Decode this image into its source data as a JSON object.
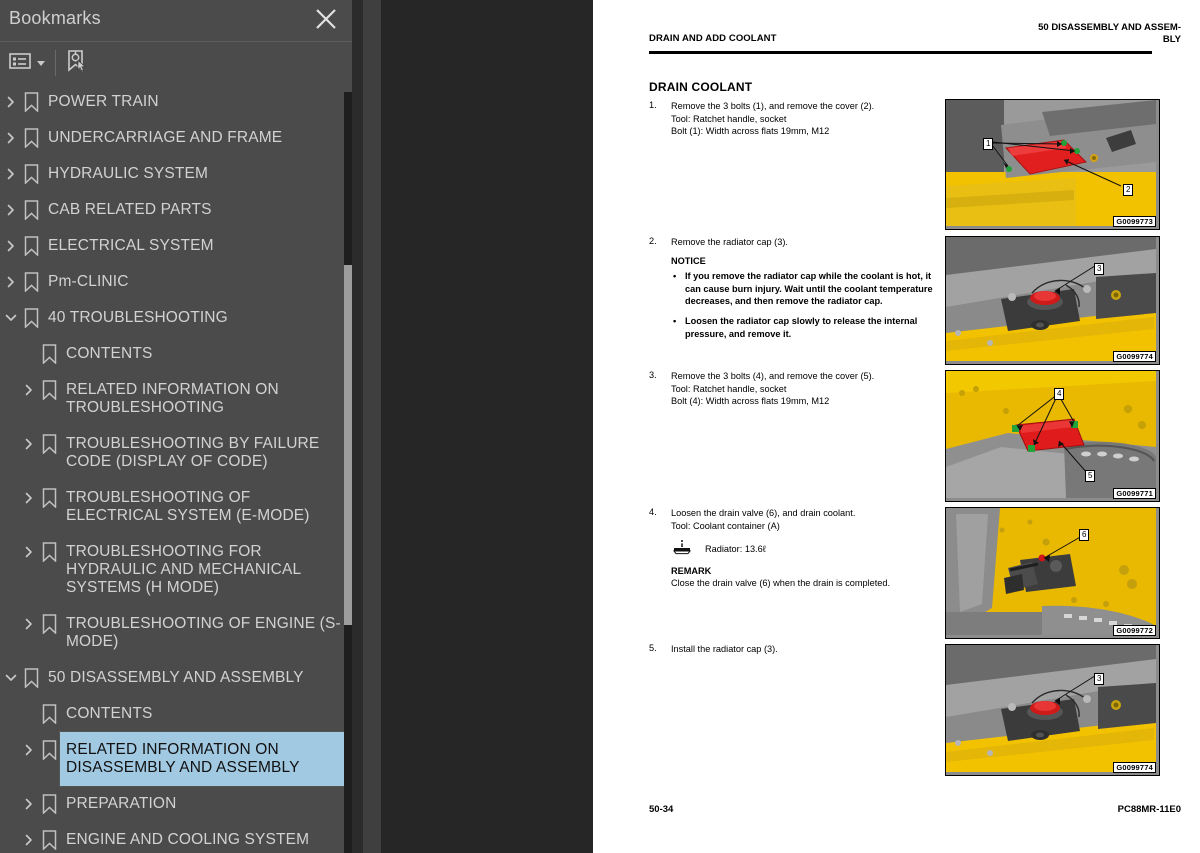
{
  "panel": {
    "title": "Bookmarks",
    "close_label": "close-panel",
    "toolbar": {
      "options_label": "Bookmark options",
      "new_bookmark_label": "New bookmark"
    }
  },
  "tree": {
    "items": [
      {
        "label": "POWER TRAIN",
        "level": 0,
        "expandable": true,
        "expanded": false,
        "selected": false
      },
      {
        "label": "UNDERCARRIAGE AND FRAME",
        "level": 0,
        "expandable": true,
        "expanded": false,
        "selected": false
      },
      {
        "label": "HYDRAULIC SYSTEM",
        "level": 0,
        "expandable": true,
        "expanded": false,
        "selected": false
      },
      {
        "label": "CAB RELATED PARTS",
        "level": 0,
        "expandable": true,
        "expanded": false,
        "selected": false
      },
      {
        "label": "ELECTRICAL SYSTEM",
        "level": 0,
        "expandable": true,
        "expanded": false,
        "selected": false
      },
      {
        "label": "Pm-CLINIC",
        "level": 0,
        "expandable": true,
        "expanded": false,
        "selected": false
      },
      {
        "label": "40 TROUBLESHOOTING",
        "level": 0,
        "expandable": true,
        "expanded": true,
        "selected": false
      },
      {
        "label": "CONTENTS",
        "level": 1,
        "expandable": false,
        "expanded": false,
        "selected": false
      },
      {
        "label": "RELATED INFORMATION ON TROUBLESHOOTING",
        "level": 1,
        "expandable": true,
        "expanded": false,
        "selected": false
      },
      {
        "label": "TROUBLESHOOTING BY FAILURE CODE (DISPLAY OF CODE)",
        "level": 1,
        "expandable": true,
        "expanded": false,
        "selected": false
      },
      {
        "label": "TROUBLESHOOTING OF ELECTRICAL SYSTEM (E-MODE)",
        "level": 1,
        "expandable": true,
        "expanded": false,
        "selected": false
      },
      {
        "label": "TROUBLESHOOTING FOR HYDRAULIC AND MECHANICAL SYSTEMS (H MODE)",
        "level": 1,
        "expandable": true,
        "expanded": false,
        "selected": false
      },
      {
        "label": "TROUBLESHOOTING OF ENGINE (S-MODE)",
        "level": 1,
        "expandable": true,
        "expanded": false,
        "selected": false
      },
      {
        "label": "50 DISASSEMBLY AND ASSEMBLY",
        "level": 0,
        "expandable": true,
        "expanded": true,
        "selected": false
      },
      {
        "label": "CONTENTS",
        "level": 1,
        "expandable": false,
        "expanded": false,
        "selected": false
      },
      {
        "label": "RELATED INFORMATION ON DISASSEMBLY AND ASSEMBLY",
        "level": 1,
        "expandable": true,
        "expanded": false,
        "selected": true
      },
      {
        "label": "PREPARATION",
        "level": 1,
        "expandable": true,
        "expanded": false,
        "selected": false
      },
      {
        "label": "ENGINE AND COOLING SYSTEM",
        "level": 1,
        "expandable": true,
        "expanded": false,
        "selected": false
      }
    ]
  },
  "document": {
    "header_left": "DRAIN AND ADD COOLANT",
    "header_right": "50 DISASSEMBLY AND ASSEM-\nBLY",
    "section_title": "DRAIN COOLANT",
    "footer_left": "50-34",
    "footer_right": "PC88MR-11E0",
    "steps": [
      {
        "num": "1.",
        "lines": [
          "Remove the 3 bolts (1), and remove the cover (2).",
          "Tool: Ratchet handle, socket",
          "Bolt (1): Width across flats 19mm, M12"
        ]
      },
      {
        "num": "2.",
        "lines": [
          "Remove the radiator cap (3)."
        ],
        "notice_head": "NOTICE",
        "bullets": [
          "If you remove the radiator cap while the coolant is hot, it can cause burn injury. Wait until the coolant temperature decreases, and then remove the radiator cap.",
          "Loosen the radiator cap slowly to release the internal pressure, and remove it."
        ]
      },
      {
        "num": "3.",
        "lines": [
          "Remove the 3 bolts (4), and remove the cover (5).",
          "Tool: Ratchet handle, socket",
          "Bolt (4): Width across flats 19mm, M12"
        ]
      },
      {
        "num": "4.",
        "lines": [
          "Loosen the drain valve (6), and drain coolant.",
          "Tool: Coolant container (A)"
        ],
        "capacity_icon": "drain-symbol-icon",
        "capacity_text": "Radiator: 13.6ℓ",
        "remark_head": "REMARK",
        "remark_text": "Close the drain valve (6) when the drain is completed."
      },
      {
        "num": "5.",
        "lines": [
          "Install the radiator cap (3)."
        ]
      }
    ],
    "figures": [
      {
        "code": "G0099773",
        "callouts": [
          "1",
          "2"
        ]
      },
      {
        "code": "G0099774",
        "callouts": [
          "3"
        ]
      },
      {
        "code": "G0099771",
        "callouts": [
          "4",
          "5"
        ]
      },
      {
        "code": "G0099772",
        "callouts": [
          "6"
        ]
      },
      {
        "code": "G0099774",
        "callouts": [
          "3"
        ]
      }
    ]
  },
  "colors": {
    "panel_bg": "#4b4b4b",
    "selection": "#a2c9e2",
    "doc_bg": "#262626",
    "page_bg": "#ffffff",
    "machine_yellow": "#f2c200",
    "part_red": "#e01b1b"
  }
}
